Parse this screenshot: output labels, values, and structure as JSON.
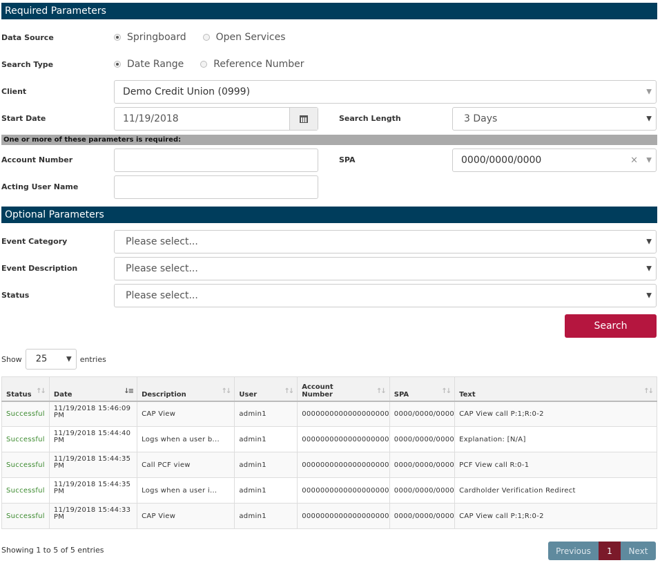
{
  "required": {
    "header": "Required Parameters",
    "data_source": {
      "label": "Data Source",
      "options": [
        "Springboard",
        "Open Services"
      ],
      "selected": "Springboard"
    },
    "search_type": {
      "label": "Search Type",
      "options": [
        "Date Range",
        "Reference Number"
      ],
      "selected": "Date Range"
    },
    "client": {
      "label": "Client",
      "value": "Demo Credit Union (0999)"
    },
    "start_date": {
      "label": "Start Date",
      "value": "11/19/2018"
    },
    "search_length": {
      "label": "Search Length",
      "value": "3 Days"
    },
    "one_or_more_note": "One or more of these parameters is required:",
    "account_number": {
      "label": "Account Number",
      "value": ""
    },
    "spa": {
      "label": "SPA",
      "value": "0000/0000/0000"
    },
    "acting_user": {
      "label": "Acting User Name",
      "value": ""
    }
  },
  "optional": {
    "header": "Optional Parameters",
    "event_category": {
      "label": "Event Category",
      "placeholder": "Please select..."
    },
    "event_description": {
      "label": "Event Description",
      "placeholder": "Please select..."
    },
    "status": {
      "label": "Status",
      "placeholder": "Please select..."
    }
  },
  "search_button": "Search",
  "length_control": {
    "show": "Show",
    "value": "25",
    "entries": "entries"
  },
  "table": {
    "columns": [
      "Status",
      "Date",
      "Description",
      "User",
      "Account Number",
      "SPA",
      "Text"
    ],
    "rows": [
      {
        "status": "Successful",
        "date": "11/19/2018 15:46:09 PM",
        "description": "CAP View",
        "user": "admin1",
        "account": "0000000000000000000",
        "spa": "0000/0000/0000",
        "text": "CAP View call P:1;R:0-2"
      },
      {
        "status": "Successful",
        "date": "11/19/2018 15:44:40 PM",
        "description": "Logs when a user b...",
        "user": "admin1",
        "account": "0000000000000000000",
        "spa": "0000/0000/0000",
        "text": "Explanation: [N/A]"
      },
      {
        "status": "Successful",
        "date": "11/19/2018 15:44:35 PM",
        "description": "Call PCF view",
        "user": "admin1",
        "account": "0000000000000000000",
        "spa": "0000/0000/0000",
        "text": "PCF View call R:0-1"
      },
      {
        "status": "Successful",
        "date": "11/19/2018 15:44:35 PM",
        "description": "Logs when a user i...",
        "user": "admin1",
        "account": "0000000000000000000",
        "spa": "0000/0000/0000",
        "text": "Cardholder Verification Redirect"
      },
      {
        "status": "Successful",
        "date": "11/19/2018 15:44:33 PM",
        "description": "CAP View",
        "user": "admin1",
        "account": "0000000000000000000",
        "spa": "0000/0000/0000",
        "text": "CAP View call P:1;R:0-2"
      }
    ]
  },
  "info": "Showing 1 to 5 of 5 entries",
  "pagination": {
    "previous": "Previous",
    "current": "1",
    "next": "Next"
  }
}
